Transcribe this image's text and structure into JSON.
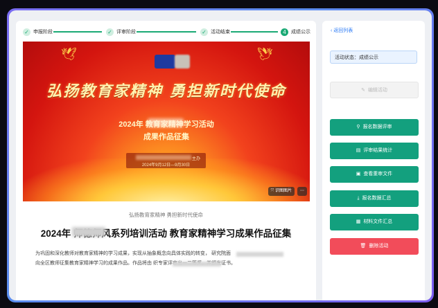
{
  "steps": [
    {
      "label": "申报阶段",
      "marker": "✓"
    },
    {
      "label": "评审阶段",
      "marker": "✓"
    },
    {
      "label": "活动结束",
      "marker": "✓"
    },
    {
      "label": "成绩公示",
      "marker": "4"
    }
  ],
  "banner": {
    "headline": "弘扬教育家精神 勇担新时代使命",
    "subtitle_line1": "2024年        教育家精神学习活动",
    "subtitle_line2": "成果作品征集",
    "date_range": "2024年9月12日—9月30日",
    "org_suffix": "主办",
    "controls": {
      "identify_label": "识图图片",
      "more_label": "⋯"
    }
  },
  "article": {
    "caption": "弘扬教育家精神 勇担新时代使命",
    "title": "2024年          师德师风系列培训活动 教育家精神学习成果作品征集",
    "paragraph_line1": "为巩固和深化教师对教育家精神的学习成果，实现从抽象概念向具体实践的转变，                研究院面",
    "paragraph_line2": "向全区教师征集教育家精神学习的成果作品。作品将由                  织专家评审出一二等奖，并颁发证书。"
  },
  "sidebar": {
    "back_label": "返回列表",
    "status_text": "活动状态：成绩公示",
    "disabled_button": {
      "label": "编辑活动",
      "icon": "pencil-icon"
    },
    "buttons": [
      {
        "label": "报名数据评审",
        "icon": "pin-icon",
        "color": "#13a07e"
      },
      {
        "label": "评审结果统计",
        "icon": "chart-icon",
        "color": "#13a07e"
      },
      {
        "label": "查看重审文件",
        "icon": "file-icon",
        "color": "#13a07e"
      },
      {
        "label": "报名数据汇总",
        "icon": "download-icon",
        "color": "#13a07e"
      },
      {
        "label": "材料文件汇总",
        "icon": "doc-icon",
        "color": "#13a07e"
      }
    ],
    "delete_button": {
      "label": "删除活动",
      "icon": "trash-icon",
      "color": "#f24c5a"
    }
  }
}
